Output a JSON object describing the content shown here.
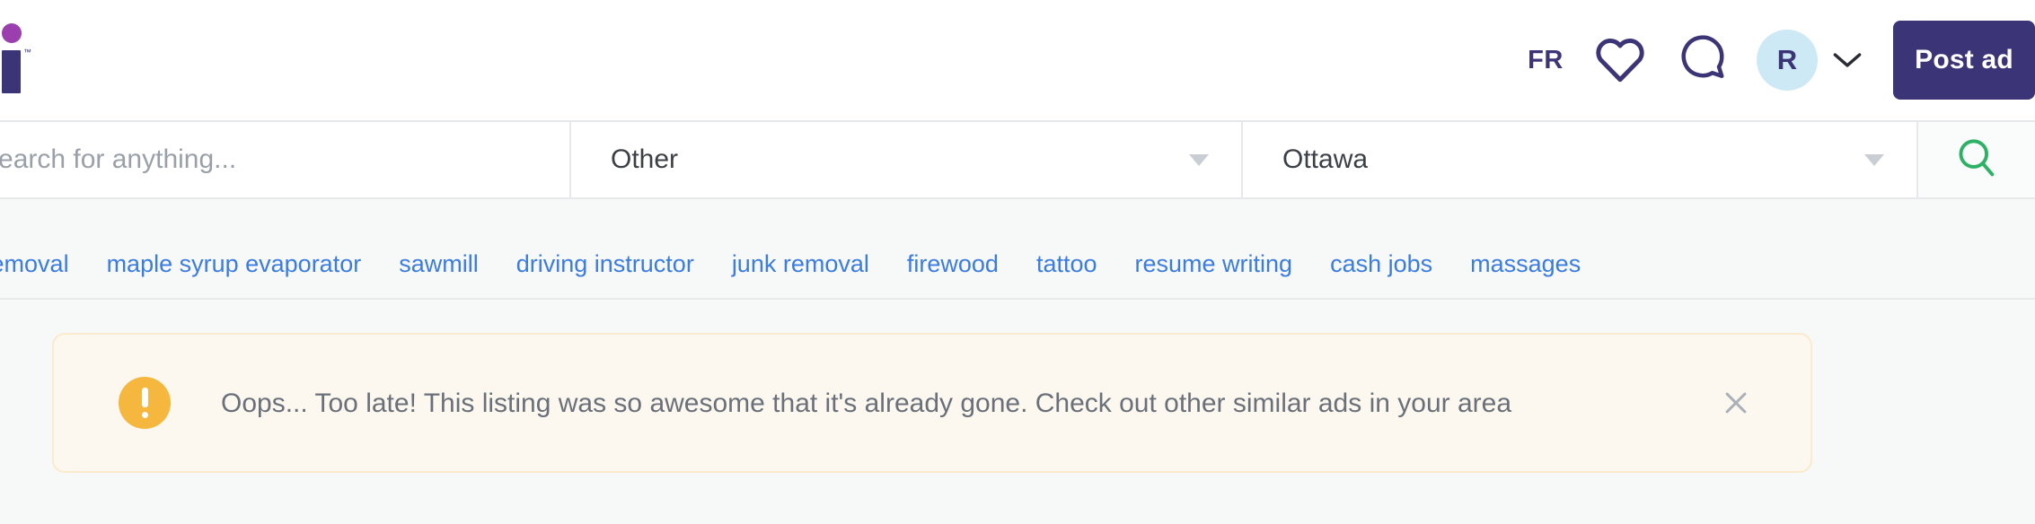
{
  "brand": {
    "logo_name": "kijiji-logo",
    "logo_trademark": "™",
    "dot_color": "#9b3fae",
    "stem_color": "#3b3577"
  },
  "header": {
    "language_toggle": "FR",
    "favorites_icon": "heart-icon",
    "messages_icon": "chat-bubble-icon",
    "avatar_initial": "R",
    "avatar_bg": "#cde9f5",
    "account_chevron_icon": "chevron-down-icon",
    "post_ad_label": "Post ad",
    "post_ad_bg": "#3b3577"
  },
  "search": {
    "placeholder": "Search for anything...",
    "value": "",
    "category_label": "Other",
    "location_label": "Ottawa",
    "submit_icon": "search-icon",
    "submit_icon_color": "#2db265"
  },
  "trending": {
    "links": [
      "snow removal",
      "maple syrup evaporator",
      "sawmill",
      "driving instructor",
      "junk removal",
      "firewood",
      "tattoo",
      "resume writing",
      "cash jobs",
      "massages"
    ],
    "link_color": "#3b7ce0"
  },
  "alert": {
    "icon": "exclamation-circle-icon",
    "icon_color": "#f5b73d",
    "message": "Oops... Too late! This listing was so awesome that it's already gone. Check out other similar ads in your area",
    "close_icon": "close-icon",
    "background": "#fdf8ef",
    "border_color": "#faeace"
  }
}
